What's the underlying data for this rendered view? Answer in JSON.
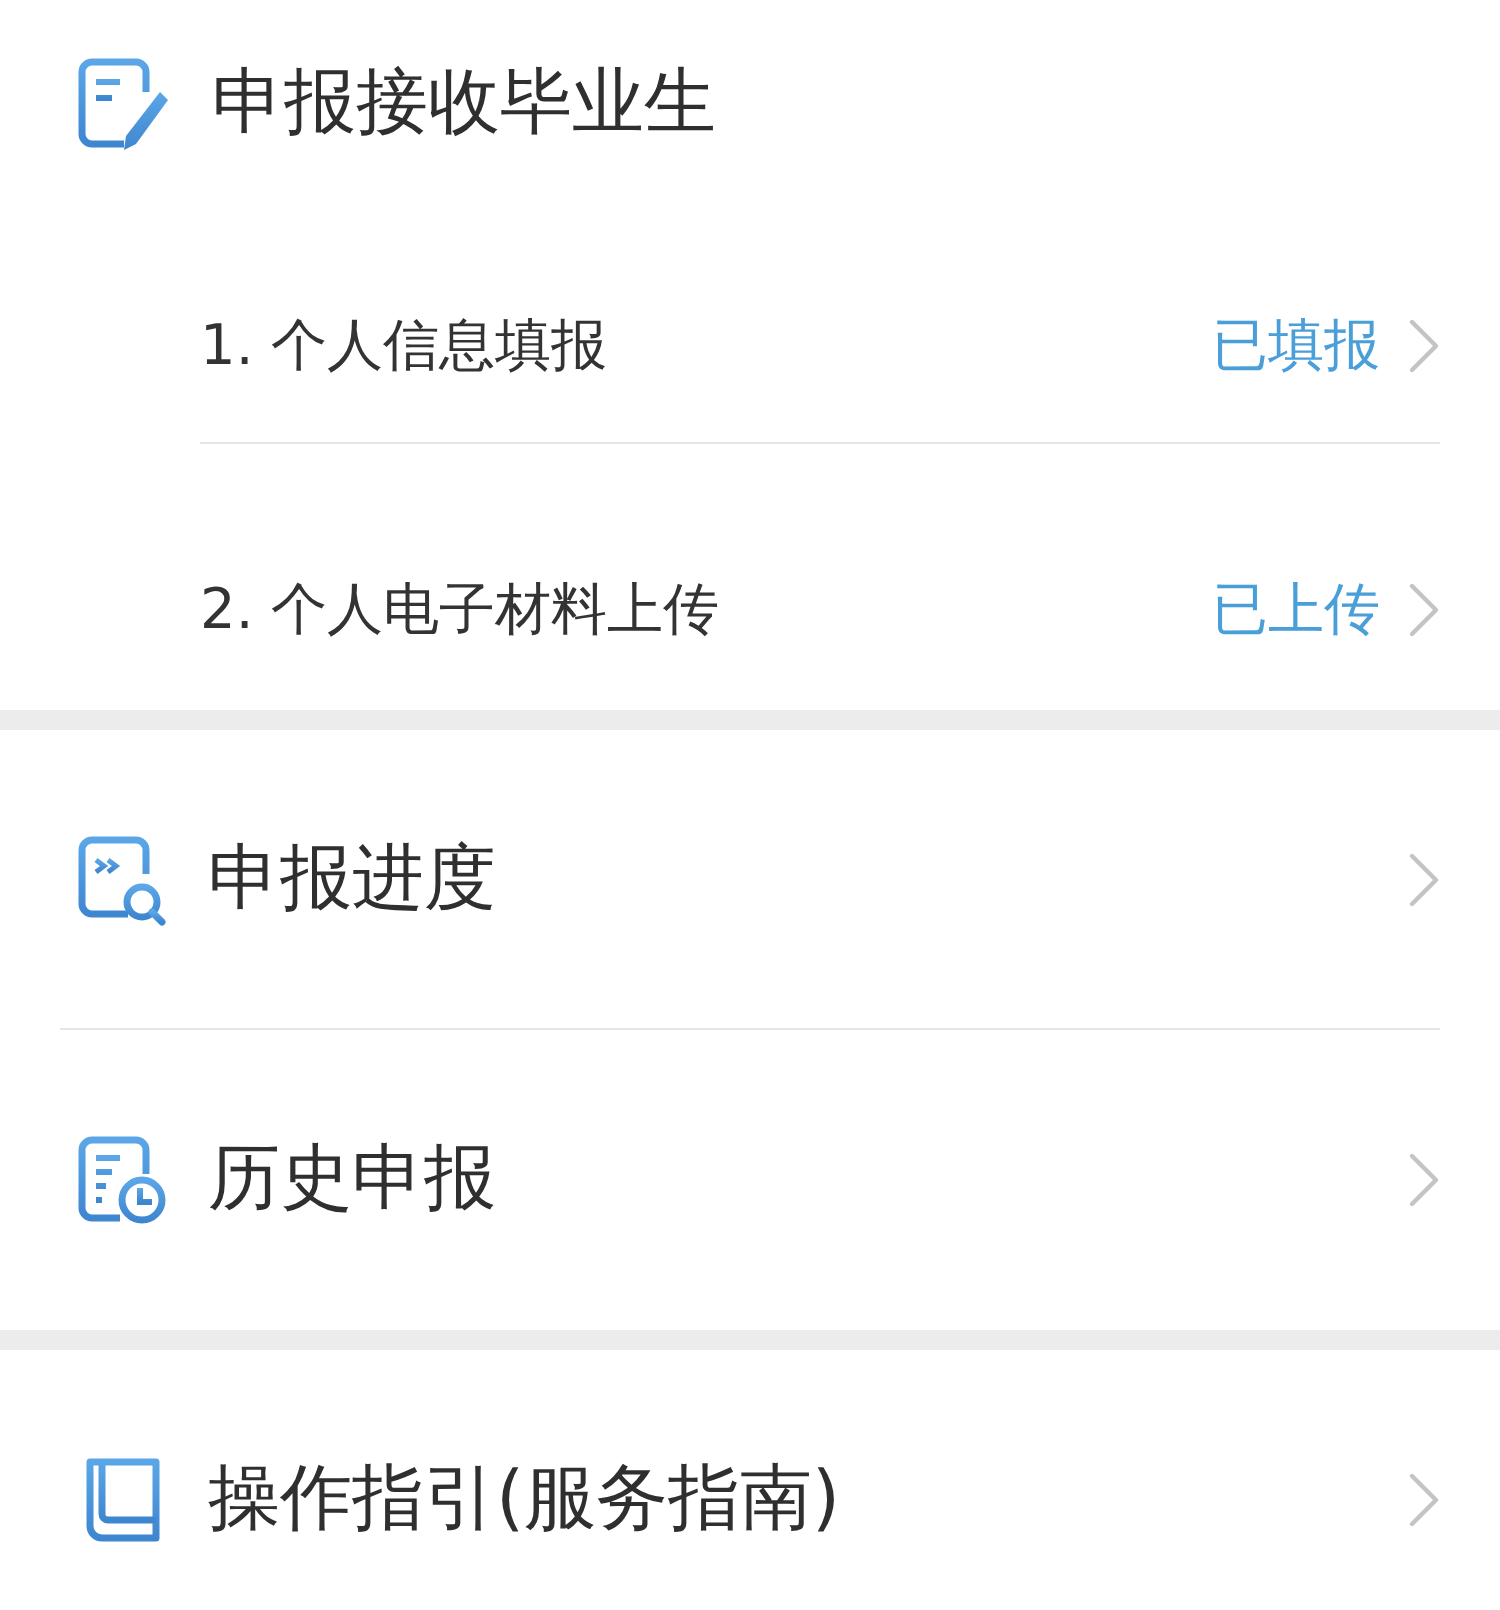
{
  "header": {
    "title": "申报接收毕业生"
  },
  "steps": [
    {
      "label": "1. 个人信息填报",
      "status": "已填报"
    },
    {
      "label": "2. 个人电子材料上传",
      "status": "已上传"
    }
  ],
  "menu_groups": [
    [
      {
        "label": "申报进度"
      },
      {
        "label": "历史申报"
      }
    ],
    [
      {
        "label": "操作指引(服务指南)"
      }
    ]
  ]
}
